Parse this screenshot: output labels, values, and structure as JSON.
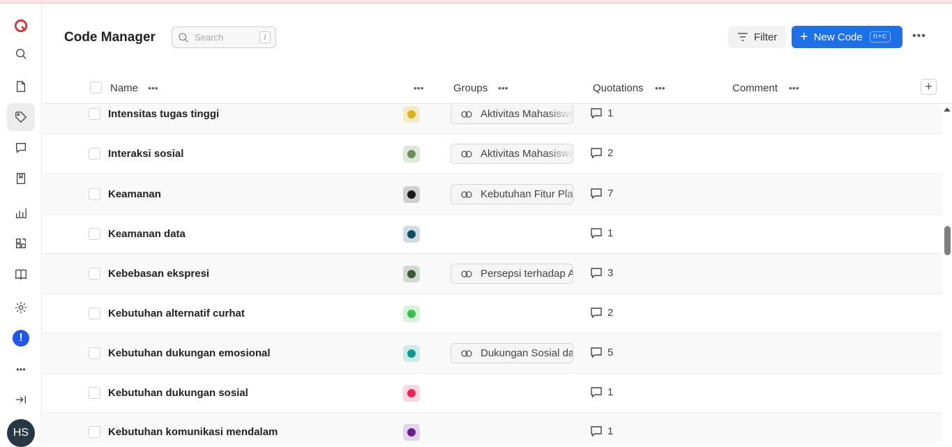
{
  "app": {
    "page_title": "Code Manager"
  },
  "search": {
    "placeholder": "Search",
    "shortcut": "/"
  },
  "toolbar": {
    "filter_label": "Filter",
    "new_code_label": "New Code",
    "new_code_shortcut": "n+c",
    "more": "•••"
  },
  "sidebar": {
    "items": [
      {
        "icon": "logo-icon"
      },
      {
        "icon": "search-icon"
      },
      {
        "icon": "document-icon"
      },
      {
        "icon": "tag-icon",
        "active": true
      },
      {
        "icon": "comment-icon"
      },
      {
        "icon": "memo-icon"
      },
      {
        "icon": "chart-icon"
      },
      {
        "icon": "network-icon"
      },
      {
        "icon": "book-icon"
      },
      {
        "icon": "gear-icon"
      },
      {
        "icon": "alert-icon"
      },
      {
        "icon": "more-icon"
      },
      {
        "icon": "collapse-icon"
      }
    ],
    "alert_glyph": "!",
    "more_glyph": "•••",
    "avatar_initials": "HS"
  },
  "table": {
    "columns": {
      "name": "Name",
      "groups": "Groups",
      "quotations": "Quotations",
      "comment": "Comment"
    },
    "column_menu": "•••",
    "add_column": "+",
    "rows": [
      {
        "name": "Intensitas tugas tinggi",
        "color": "#d9b21f",
        "swatch_bg": "#f3ecc9",
        "group": "Aktivitas Mahasiswa",
        "quotations": "1"
      },
      {
        "name": "Interaksi sosial",
        "color": "#6b8f5c",
        "swatch_bg": "#dfe6da",
        "group": "Aktivitas Mahasiswa",
        "quotations": "2"
      },
      {
        "name": "Keamanan",
        "color": "#1a1a1a",
        "swatch_bg": "#cfcfcf",
        "group": "Kebutuhan Fitur Platform",
        "quotations": "7"
      },
      {
        "name": "Keamanan data",
        "color": "#0d4f63",
        "swatch_bg": "#cfdde2",
        "group": "",
        "quotations": "1"
      },
      {
        "name": "Kebebasan ekspresi",
        "color": "#3f5638",
        "swatch_bg": "#d3d8d1",
        "group": "Persepsi terhadap Anonimitas",
        "quotations": "3"
      },
      {
        "name": "Kebutuhan alternatif curhat",
        "color": "#3bbf4d",
        "swatch_bg": "#d8f2dc",
        "group": "",
        "quotations": "2"
      },
      {
        "name": "Kebutuhan dukungan emosional",
        "color": "#0f9a8e",
        "swatch_bg": "#cdeae7",
        "group": "Dukungan Sosial dan Emosional",
        "quotations": "5"
      },
      {
        "name": "Kebutuhan dukungan sosial",
        "color": "#e8265c",
        "swatch_bg": "#f9d6e0",
        "group": "",
        "quotations": "1"
      },
      {
        "name": "Kebutuhan komunikasi mendalam",
        "color": "#6a2091",
        "swatch_bg": "#e2d5ea",
        "group": "",
        "quotations": "1"
      }
    ]
  }
}
